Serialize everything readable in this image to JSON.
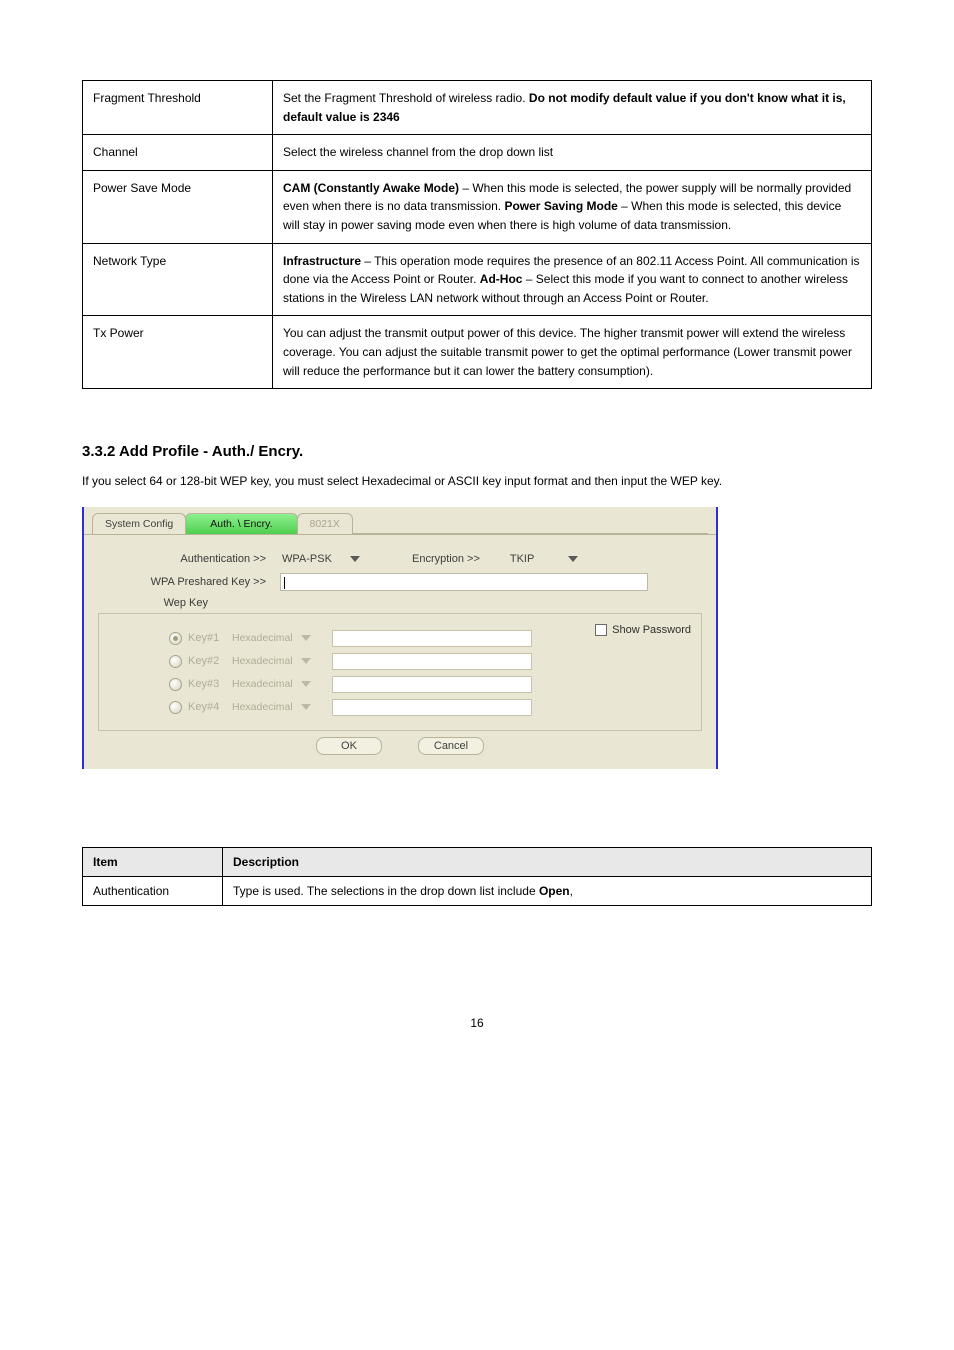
{
  "defs": [
    {
      "term": "Fragment Threshold",
      "desc": "Set the Fragment Threshold of wireless radio. <b>Do not modify default value if you don't know what it is, default value is 2346</b>"
    },
    {
      "term": "Channel",
      "desc": "Select the wireless channel from the drop down list"
    },
    {
      "term": "Power Save Mode",
      "desc": "<b>CAM (Constantly Awake Mode)</b> – When this mode is selected, the power supply will be normally provided even when there is no data transmission. <b>Power Saving Mode</b> – When this mode is selected, this device will stay in power saving mode even when there is high volume of data transmission."
    },
    {
      "term": "Network Type",
      "desc": "<b>Infrastructure</b> – This operation mode requires the presence of an 802.11 Access Point. All communication is done via the Access Point or Router. <b>Ad-Hoc</b> – Select this mode if you want to connect to another wireless stations in the Wireless LAN network without through an Access Point or Router."
    },
    {
      "term": "Tx Power",
      "desc": "You can adjust the transmit output power of this device. The higher transmit power will extend the wireless coverage. You can adjust the suitable transmit power to get the optimal performance (Lower transmit power will reduce the performance but it can lower the battery consumption)."
    }
  ],
  "section_title": "3.3.2 Add Profile - Auth./ Encry.",
  "section_body": "If you select 64 or 128-bit WEP key, you must select Hexadecimal or ASCII key input format and then input the WEP key.",
  "shot": {
    "tabs": {
      "sys": "System Config",
      "auth": "Auth. \\ Encry.",
      "dot1x": "8021X"
    },
    "labels": {
      "auth": "Authentication >>",
      "encr": "Encryption >>",
      "psk": "WPA Preshared Key >>",
      "wep": "Wep Key"
    },
    "auth_value": "WPA-PSK",
    "encr_value": "TKIP",
    "keys": [
      {
        "label": "Key#1",
        "mode": "Hexadecimal"
      },
      {
        "label": "Key#2",
        "mode": "Hexadecimal"
      },
      {
        "label": "Key#3",
        "mode": "Hexadecimal"
      },
      {
        "label": "Key#4",
        "mode": "Hexadecimal"
      }
    ],
    "showpw": "Show Password",
    "ok": "OK",
    "cancel": "Cancel"
  },
  "desc": {
    "head_item": "Item",
    "head_desc": "Description",
    "row_item": "Authentication",
    "row_desc": "Type is used. The selections in the drop down list include <b>Open</b>,"
  },
  "page_number": "16"
}
